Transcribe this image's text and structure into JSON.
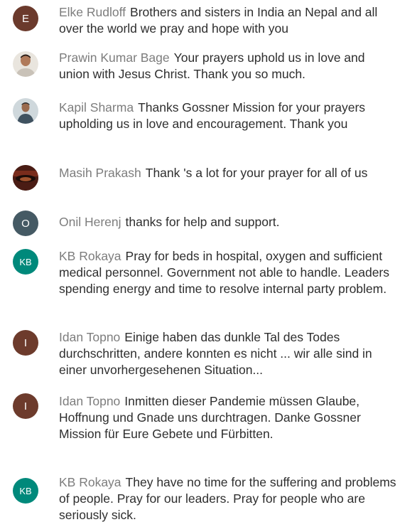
{
  "comments": [
    {
      "author": "Elke Rudloff",
      "avatar_letter": "E",
      "avatar_color": "#6b3a2c",
      "text": "Brothers and sisters in India an Nepal and all over the world we pray and hope with you"
    },
    {
      "author": "Prawin Kumar Bage",
      "avatar_icon": "profile-photo-icon",
      "text": "Your prayers uphold us in love and union with Jesus Christ. Thank you so much."
    },
    {
      "author": "Kapil Sharma",
      "avatar_icon": "profile-photo-icon",
      "text": "Thanks Gossner Mission for your prayers upholding us in love and encouragement. Thank you"
    },
    {
      "author": "Masih Prakash",
      "avatar_icon": "profile-photo-icon",
      "text": "Thank 's a lot for your prayer for all of us"
    },
    {
      "author": "Onil Herenj",
      "avatar_letter": "O",
      "avatar_color": "#455a64",
      "text": "thanks for help and support."
    },
    {
      "author": "KB Rokaya",
      "avatar_letter": "KB",
      "avatar_color": "#00897b",
      "text": "Pray for beds in hospital, oxygen and sufficient medical personnel. Government not able to handle. Leaders spending energy and time to resolve internal party problem."
    },
    {
      "author": "Idan Topno",
      "avatar_letter": "I",
      "avatar_color": "#6d3b2c",
      "text": "Einige haben das dunkle Tal des Todes durchschritten, andere konnten es nicht ... wir alle sind in einer unvorhergesehenen Situation..."
    },
    {
      "author": "Idan Topno",
      "avatar_letter": "I",
      "avatar_color": "#6d3b2c",
      "text": "Inmitten dieser Pandemie müssen Glaube, Hoffnung und Gnade uns durchtragen. Danke Gossner Mission für Eure Gebete und Fürbitten."
    },
    {
      "author": "KB Rokaya",
      "avatar_letter": "KB",
      "avatar_color": "#00897b",
      "text": "They have no time for the suffering and problems of people. Pray for our leaders. Pray for people who are seriously sick."
    }
  ]
}
